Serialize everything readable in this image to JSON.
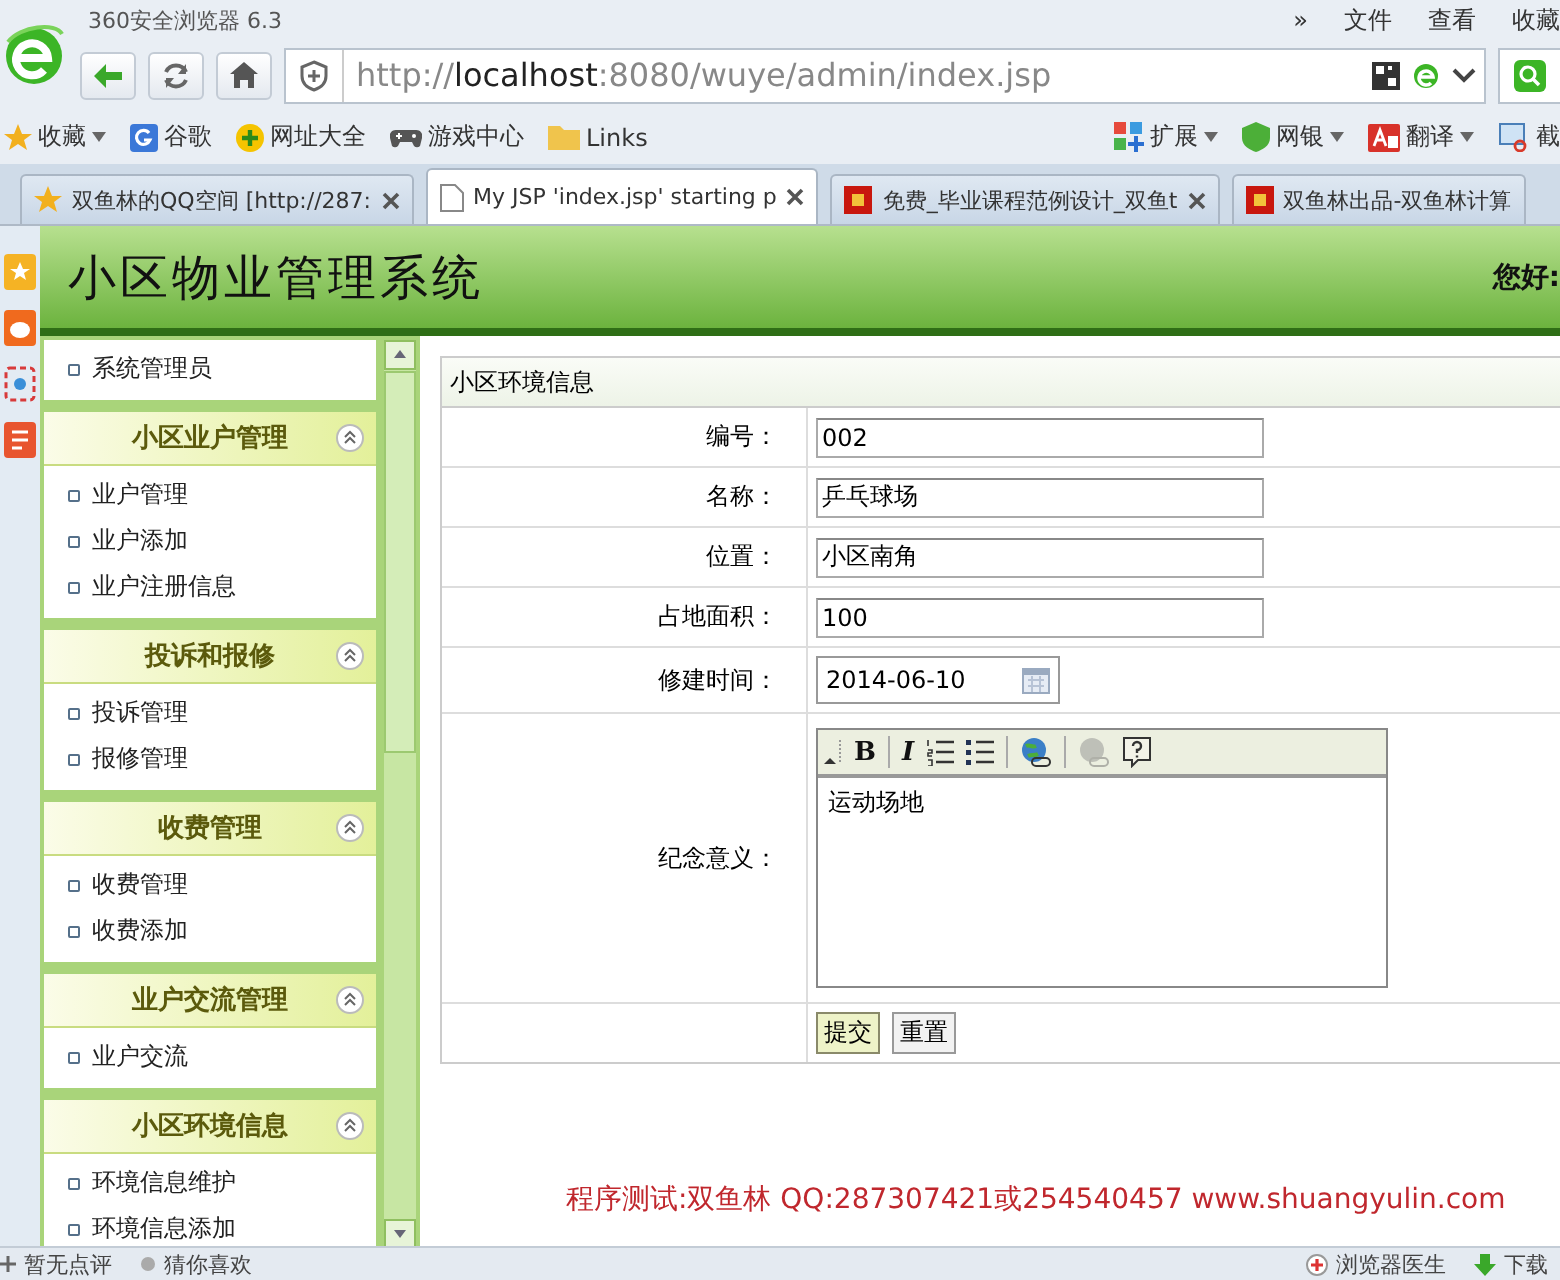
{
  "browser": {
    "title": "360安全浏览器 6.3",
    "menu": [
      "»",
      "文件",
      "查看",
      "收藏"
    ],
    "address": [
      "http://",
      "localhost",
      ":8080/wuye/admin/index.jsp"
    ],
    "bookmarks": [
      {
        "kind": "star",
        "label": "收藏",
        "dropdown": true
      },
      {
        "kind": "google",
        "label": "谷歌",
        "dropdown": false
      },
      {
        "kind": "globe",
        "label": "网址大全",
        "dropdown": false
      },
      {
        "kind": "gamepad",
        "label": "游戏中心",
        "dropdown": false
      },
      {
        "kind": "folder",
        "label": "Links",
        "dropdown": false
      }
    ],
    "extensions": [
      {
        "kind": "grid",
        "label": "扩展",
        "dropdown": true
      },
      {
        "kind": "shield",
        "label": "网银",
        "dropdown": true
      },
      {
        "kind": "translate",
        "label": "翻译",
        "dropdown": true
      },
      {
        "kind": "scissors",
        "label": "截",
        "dropdown": false
      }
    ],
    "tabs": [
      {
        "title": "双鱼林的QQ空间 [http://287:",
        "kind": "favorite",
        "selected": false,
        "closable": true
      },
      {
        "title": "My JSP 'index.jsp' starting p",
        "kind": "page",
        "selected": true,
        "closable": true
      },
      {
        "title": "免费_毕业课程范例设计_双鱼t",
        "kind": "site",
        "selected": false,
        "closable": true
      },
      {
        "title": "双鱼林出品-双鱼林计算",
        "kind": "site",
        "selected": false,
        "closable": false
      }
    ]
  },
  "app": {
    "title": "小区物业管理系统",
    "greeting": "您好:"
  },
  "menu": {
    "top_items": [
      "系统管理员"
    ],
    "sections": [
      {
        "title": "小区业户管理",
        "expanded": true,
        "items": [
          "业户管理",
          "业户添加",
          "业户注册信息"
        ]
      },
      {
        "title": "投诉和报修",
        "expanded": true,
        "items": [
          "投诉管理",
          "报修管理"
        ]
      },
      {
        "title": "收费管理",
        "expanded": true,
        "items": [
          "收费管理",
          "收费添加"
        ]
      },
      {
        "title": "业户交流管理",
        "expanded": true,
        "items": [
          "业户交流"
        ]
      },
      {
        "title": "小区环境信息",
        "expanded": true,
        "items": [
          "环境信息维护",
          "环境信息添加"
        ]
      }
    ]
  },
  "form": {
    "title": "小区环境信息",
    "fields": [
      {
        "kind": "text",
        "label": "编号：",
        "value": "002"
      },
      {
        "kind": "text",
        "label": "名称：",
        "value": "乒乓球场"
      },
      {
        "kind": "text",
        "label": "位置：",
        "value": "小区南角"
      },
      {
        "kind": "text",
        "label": "占地面积：",
        "value": "100"
      },
      {
        "kind": "date",
        "label": "修建时间：",
        "value": "2014-06-10"
      },
      {
        "kind": "editor",
        "label": "纪念意义：",
        "value": "运动场地"
      }
    ],
    "toolbar": [
      {
        "kind": "collapse",
        "disabled": false
      },
      {
        "kind": "bold",
        "label": "B",
        "disabled": false
      },
      {
        "kind": "italic",
        "label": "I",
        "disabled": false
      },
      {
        "kind": "ol",
        "disabled": false
      },
      {
        "kind": "ul",
        "disabled": false
      },
      {
        "kind": "link",
        "disabled": false
      },
      {
        "kind": "unlink",
        "disabled": true
      },
      {
        "kind": "help",
        "disabled": false
      }
    ],
    "buttons": [
      {
        "label": "提交",
        "focused": true
      },
      {
        "label": "重置",
        "focused": false
      }
    ]
  },
  "footer": "程序测试:双鱼林 QQ:287307421或254540457 www.shuangyulin.com",
  "status_bar": {
    "left": [
      "暂无点评",
      "猜你喜欢"
    ],
    "right": [
      "浏览器医生",
      "下载"
    ]
  }
}
